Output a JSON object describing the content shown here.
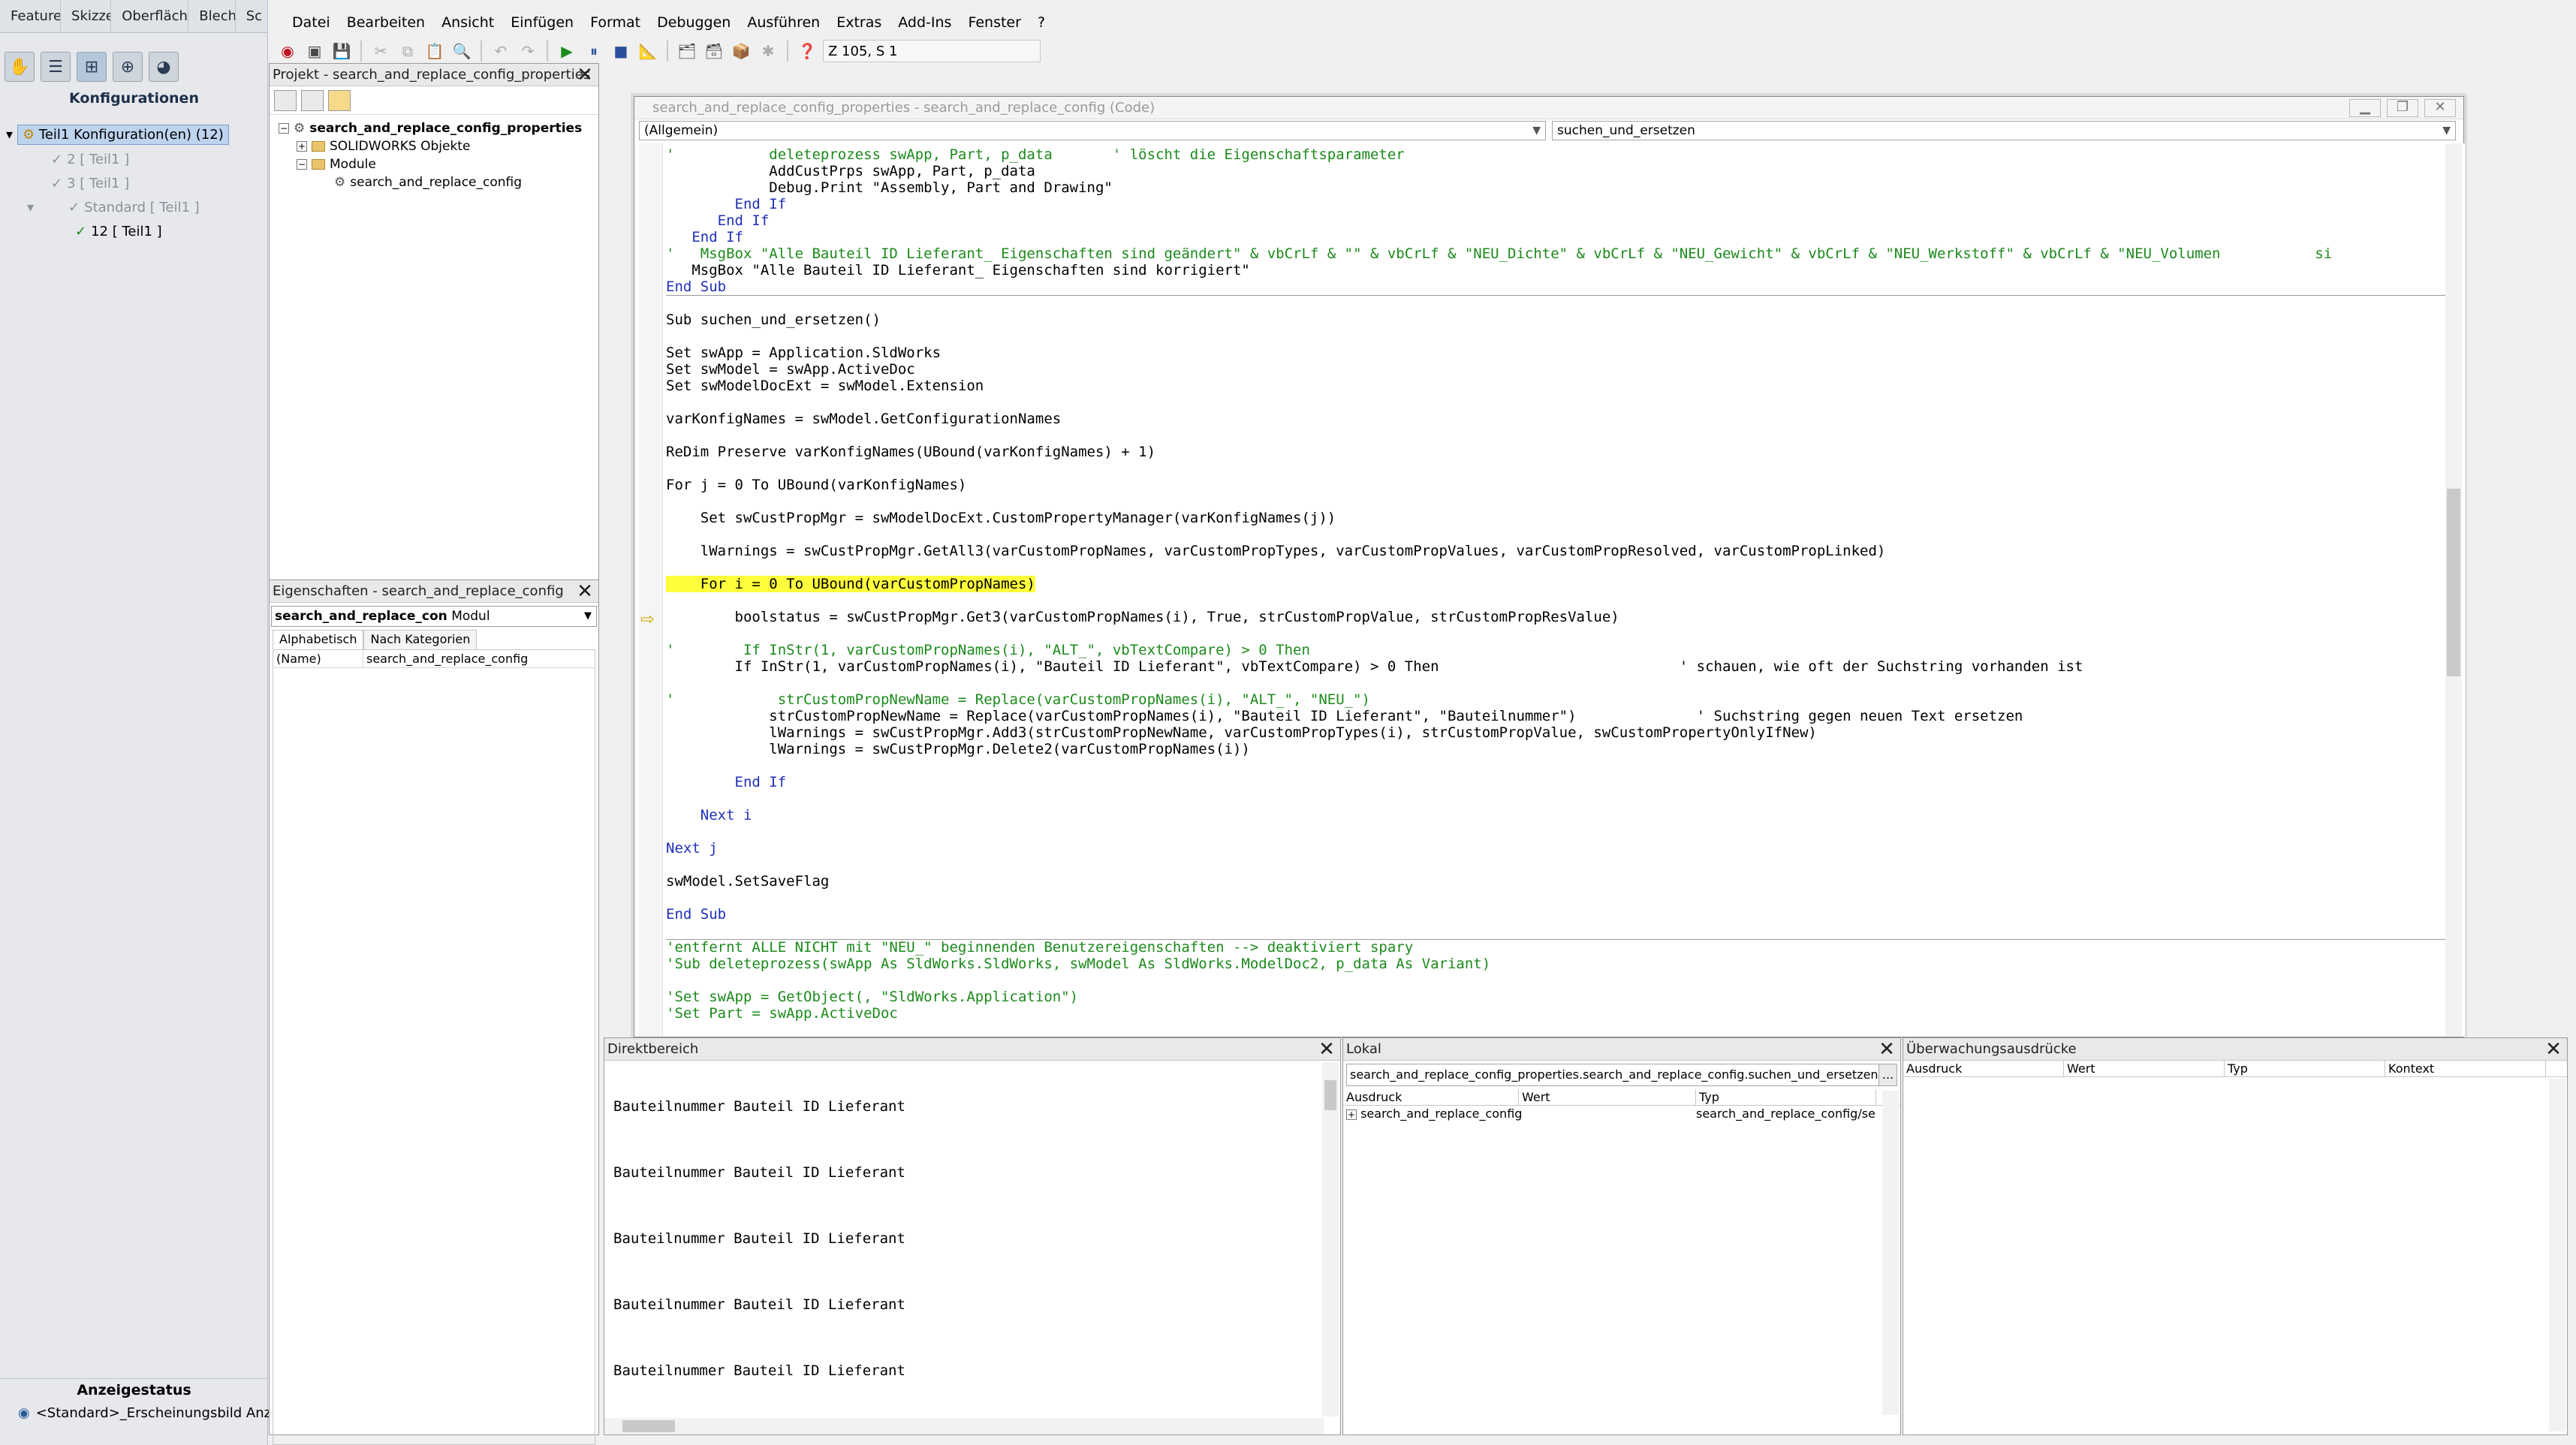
{
  "sw_tabs": [
    "Features",
    "Skizze",
    "Oberflächen",
    "Blech",
    "Sc"
  ],
  "sw_config_title": "Konfigurationen",
  "sw_tree": {
    "root": "Teil1 Konfiguration(en)  (12)",
    "items": [
      "2 [ Teil1 ]",
      "3 [ Teil1 ]",
      "Standard [ Teil1 ]",
      "12 [ Teil1 ]"
    ]
  },
  "sw_status": {
    "title": "Anzeigestatus",
    "row": "<Standard>_Erscheinungsbild Anzeig"
  },
  "menu": [
    "Datei",
    "Bearbeiten",
    "Ansicht",
    "Einfügen",
    "Format",
    "Debuggen",
    "Ausführen",
    "Extras",
    "Add-Ins",
    "Fenster",
    "?"
  ],
  "cursor_position": "Z 105, S 1",
  "project": {
    "title": "Projekt - search_and_replace_config_properties",
    "root": "search_and_replace_config_properties",
    "folder1": "SOLIDWORKS Objekte",
    "folder2": "Module",
    "module": "search_and_replace_config"
  },
  "properties": {
    "title": "Eigenschaften - search_and_replace_config",
    "combo_name": "search_and_replace_con",
    "combo_type": "Modul",
    "tab1": "Alphabetisch",
    "tab2": "Nach Kategorien",
    "row_key": "(Name)",
    "row_value": "search_and_replace_config"
  },
  "code_window": {
    "title": "search_and_replace_config_properties - search_and_replace_config (Code)",
    "combo_left": "(Allgemein)",
    "combo_right": "suchen_und_ersetzen",
    "lines": [
      {
        "t": "'           deleteprozess swApp, Part, p_data       ' löscht die Eigenschaftsparameter",
        "c": "cm"
      },
      {
        "t": "            AddCustPrps swApp, Part, p_data",
        "c": ""
      },
      {
        "t": "            Debug.Print \"Assembly, Part and Drawing\"",
        "c": ""
      },
      {
        "t": "        End If",
        "c": "kw"
      },
      {
        "t": "      End If",
        "c": "kw"
      },
      {
        "t": "   End If",
        "c": "kw"
      },
      {
        "t": "'   MsgBox \"Alle Bauteil ID Lieferant_ Eigenschaften sind geändert\" & vbCrLf & \"\" & vbCrLf & \"NEU_Dichte\" & vbCrLf & \"NEU_Gewicht\" & vbCrLf & \"NEU_Werkstoff\" & vbCrLf & \"NEU_Volumen           si",
        "c": "cm"
      },
      {
        "t": "   MsgBox \"Alle Bauteil ID Lieferant_ Eigenschaften sind korrigiert\"",
        "c": ""
      },
      {
        "t": "End Sub",
        "c": "kw"
      },
      {
        "t": "",
        "c": ""
      },
      {
        "t": "Sub suchen_und_ersetzen()",
        "c": ""
      },
      {
        "t": "",
        "c": ""
      },
      {
        "t": "Set swApp = Application.SldWorks",
        "c": ""
      },
      {
        "t": "Set swModel = swApp.ActiveDoc",
        "c": ""
      },
      {
        "t": "Set swModelDocExt = swModel.Extension",
        "c": ""
      },
      {
        "t": "",
        "c": ""
      },
      {
        "t": "varKonfigNames = swModel.GetConfigurationNames",
        "c": ""
      },
      {
        "t": "",
        "c": ""
      },
      {
        "t": "ReDim Preserve varKonfigNames(UBound(varKonfigNames) + 1)",
        "c": ""
      },
      {
        "t": "",
        "c": ""
      },
      {
        "t": "For j = 0 To UBound(varKonfigNames)",
        "c": ""
      },
      {
        "t": "",
        "c": ""
      },
      {
        "t": "    Set swCustPropMgr = swModelDocExt.CustomPropertyManager(varKonfigNames(j))",
        "c": ""
      },
      {
        "t": "",
        "c": ""
      },
      {
        "t": "    lWarnings = swCustPropMgr.GetAll3(varCustomPropNames, varCustomPropTypes, varCustomPropValues, varCustomPropResolved, varCustomPropLinked)",
        "c": ""
      },
      {
        "t": "",
        "c": ""
      },
      {
        "t": "    For i = 0 To UBound(varCustomPropNames)",
        "c": "hl"
      },
      {
        "t": "",
        "c": ""
      },
      {
        "t": "        boolstatus = swCustPropMgr.Get3(varCustomPropNames(i), True, strCustomPropValue, strCustomPropResValue)",
        "c": ""
      },
      {
        "t": "",
        "c": ""
      },
      {
        "t": "'        If InStr(1, varCustomPropNames(i), \"ALT_\", vbTextCompare) > 0 Then",
        "c": "cm"
      },
      {
        "t": "        If InStr(1, varCustomPropNames(i), \"Bauteil ID Lieferant\", vbTextCompare) > 0 Then                            ' schauen, wie oft der Suchstring vorhanden ist",
        "c": ""
      },
      {
        "t": "",
        "c": ""
      },
      {
        "t": "'            strCustomPropNewName = Replace(varCustomPropNames(i), \"ALT_\", \"NEU_\")",
        "c": "cm"
      },
      {
        "t": "            strCustomPropNewName = Replace(varCustomPropNames(i), \"Bauteil ID Lieferant\", \"Bauteilnummer\")              ' Suchstring gegen neuen Text ersetzen",
        "c": ""
      },
      {
        "t": "            lWarnings = swCustPropMgr.Add3(strCustomPropNewName, varCustomPropTypes(i), strCustomPropValue, swCustomPropertyOnlyIfNew)",
        "c": ""
      },
      {
        "t": "            lWarnings = swCustPropMgr.Delete2(varCustomPropNames(i))",
        "c": ""
      },
      {
        "t": "",
        "c": ""
      },
      {
        "t": "        End If",
        "c": "kw"
      },
      {
        "t": "",
        "c": ""
      },
      {
        "t": "    Next i",
        "c": "kw"
      },
      {
        "t": "",
        "c": ""
      },
      {
        "t": "Next j",
        "c": "kw"
      },
      {
        "t": "",
        "c": ""
      },
      {
        "t": "swModel.SetSaveFlag",
        "c": ""
      },
      {
        "t": "",
        "c": ""
      },
      {
        "t": "End Sub",
        "c": "kw"
      },
      {
        "t": "",
        "c": ""
      },
      {
        "t": "'entfernt ALLE NICHT mit \"NEU_\" beginnenden Benutzereigenschaften --> deaktiviert spary",
        "c": "cm"
      },
      {
        "t": "'Sub deleteprozess(swApp As SldWorks.SldWorks, swModel As SldWorks.ModelDoc2, p_data As Variant)",
        "c": "cm"
      },
      {
        "t": "",
        "c": ""
      },
      {
        "t": "'Set swApp = GetObject(, \"SldWorks.Application\")",
        "c": "cm"
      },
      {
        "t": "'Set Part = swApp.ActiveDoc",
        "c": "cm"
      }
    ]
  },
  "immediate": {
    "title": "Direktbereich",
    "lines": [
      "Bauteilnummer Bauteil ID Lieferant",
      "Bauteilnummer Bauteil ID Lieferant",
      "Bauteilnummer Bauteil ID Lieferant",
      "Bauteilnummer Bauteil ID Lieferant",
      "Bauteilnummer Bauteil ID Lieferant"
    ]
  },
  "locals": {
    "title": "Lokal",
    "context": "search_and_replace_config_properties.search_and_replace_config.suchen_und_ersetzen",
    "ellipsis": "...",
    "col_expr": "Ausdruck",
    "col_value": "Wert",
    "col_type": "Typ",
    "row_expr": "search_and_replace_config",
    "row_type": "search_and_replace_config/searc"
  },
  "watch": {
    "title": "Überwachungsausdrücke",
    "col_expr": "Ausdruck",
    "col_value": "Wert",
    "col_type": "Typ",
    "col_context": "Kontext"
  }
}
